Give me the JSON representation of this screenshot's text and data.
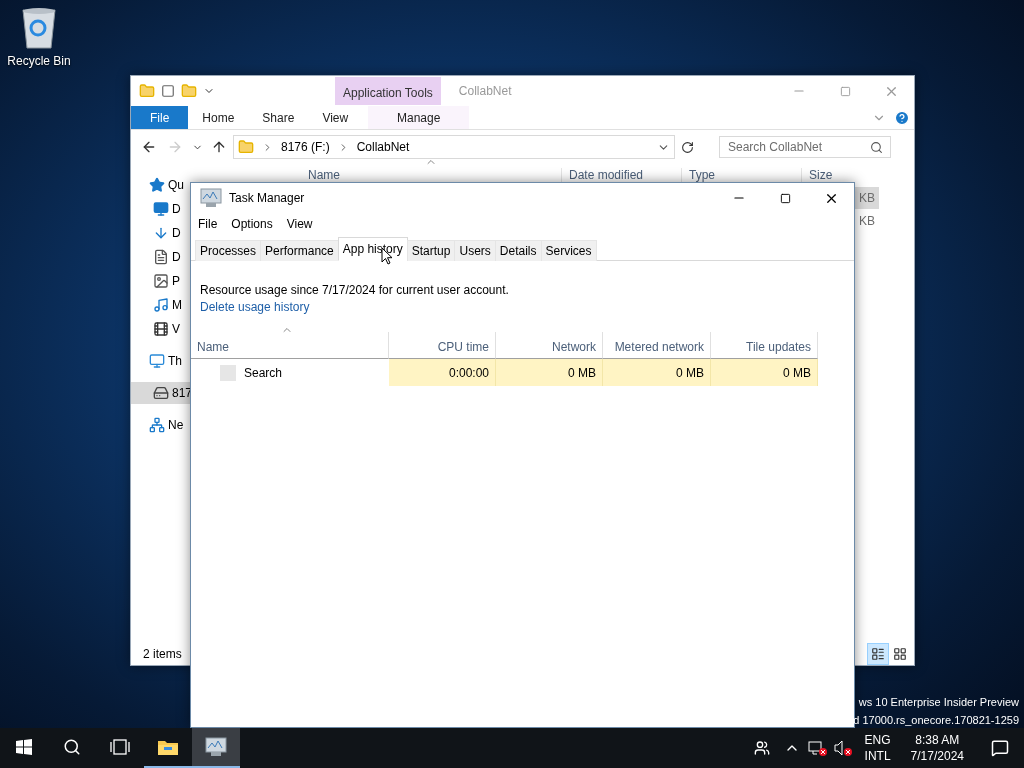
{
  "desktop_icons": [
    {
      "label": "Recycle Bin",
      "kind": "recycle_bin"
    }
  ],
  "explorer": {
    "context_group": "Application Tools",
    "title": "CollabNet",
    "ribbon_tabs": [
      {
        "label": "File",
        "kind": "backstage"
      },
      {
        "label": "Home",
        "kind": "tab"
      },
      {
        "label": "Share",
        "kind": "tab"
      },
      {
        "label": "View",
        "kind": "tab"
      },
      {
        "label": "Manage",
        "kind": "context"
      }
    ],
    "address": [
      "8176 (F:)",
      "CollabNet"
    ],
    "search": {
      "placeholder": "Search CollabNet"
    },
    "columns": [
      "Name",
      "Date modified",
      "Type",
      "Size"
    ],
    "nav_items": [
      {
        "label": "Qu",
        "kind": "star",
        "selected": false
      },
      {
        "label": "D",
        "kind": "desktop",
        "selected": false
      },
      {
        "label": "D",
        "kind": "download",
        "selected": false
      },
      {
        "label": "D",
        "kind": "document",
        "selected": false
      },
      {
        "label": "P",
        "kind": "pictures",
        "selected": false
      },
      {
        "label": "M",
        "kind": "music",
        "selected": false
      },
      {
        "label": "V",
        "kind": "video",
        "selected": false
      },
      {
        "label": "Th",
        "kind": "pc",
        "selected": false
      },
      {
        "label": "817",
        "kind": "drive",
        "selected": true
      },
      {
        "label": "Ne",
        "kind": "network",
        "selected": false
      }
    ],
    "rows": [
      {
        "size": "KB",
        "selected": true
      },
      {
        "size": "KB",
        "selected": false
      }
    ],
    "status": "2 items",
    "view_buttons": [
      {
        "kind": "details",
        "selected": true
      },
      {
        "kind": "large_icons",
        "selected": false
      }
    ]
  },
  "task_manager": {
    "title": "Task Manager",
    "menu": [
      "File",
      "Options",
      "View"
    ],
    "tabs": [
      {
        "label": "Processes",
        "selected": false
      },
      {
        "label": "Performance",
        "selected": false
      },
      {
        "label": "App history",
        "selected": true
      },
      {
        "label": "Startup",
        "selected": false
      },
      {
        "label": "Users",
        "selected": false
      },
      {
        "label": "Details",
        "selected": false
      },
      {
        "label": "Services",
        "selected": false
      }
    ],
    "summary": "Resource usage since 7/17/2024 for current user account.",
    "link": "Delete usage history",
    "columns": [
      "Name",
      "CPU time",
      "Network",
      "Metered network",
      "Tile updates"
    ],
    "rows": [
      {
        "cells": [
          "Search",
          "0:00:00",
          "0 MB",
          "0 MB",
          "0 MB"
        ]
      }
    ]
  },
  "watermark": [
    "ws 10 Enterprise Insider Preview",
    "d 17000.rs_onecore.170821-1259"
  ],
  "taskbar": {
    "buttons": [
      {
        "kind": "start",
        "running": false,
        "selected": false
      },
      {
        "kind": "search",
        "running": false,
        "selected": false
      },
      {
        "kind": "task_view",
        "running": false,
        "selected": false
      },
      {
        "kind": "file_explorer",
        "running": true,
        "selected": false
      },
      {
        "kind": "task_manager",
        "running": true,
        "selected": true
      }
    ],
    "language": [
      "ENG",
      "INTL"
    ],
    "time": "8:38 AM",
    "date": "7/17/2024"
  }
}
